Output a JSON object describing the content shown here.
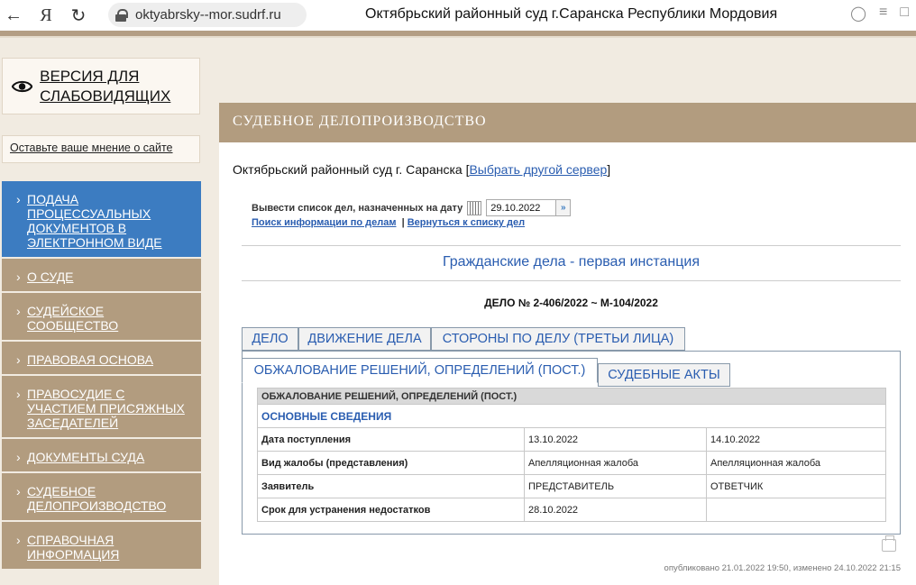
{
  "browser": {
    "url": "oktyabrsky--mor.sudrf.ru",
    "page_title": "Октябрьский районный суд г.Саранска Республики Мордовия"
  },
  "sidebar": {
    "vision_label": "ВЕРСИЯ ДЛЯ СЛАБОВИДЯЩИХ",
    "opinion_link": "Оставьте ваше мнение о сайте",
    "items": [
      {
        "label": "Подача процессуальных документов в электронном виде",
        "active": true
      },
      {
        "label": "О суде"
      },
      {
        "label": "Судейское сообщество"
      },
      {
        "label": "Правовая основа"
      },
      {
        "label": "Правосудие с участием присяжных заседателей"
      },
      {
        "label": "Документы суда"
      },
      {
        "label": "Судебное делопроизводство"
      },
      {
        "label": "Справочная информация"
      }
    ]
  },
  "main": {
    "section_title": "СУДЕБНОЕ ДЕЛОПРОИЗВОДСТВО",
    "court_name": "Октябрьский районный суд г. Саранска",
    "bracket_open": "[",
    "change_server_link": "Выбрать другой сервер",
    "bracket_close": "]",
    "date_label": "Вывести список дел, назначенных на дату",
    "date_value": "29.10.2022",
    "search_link": "Поиск информации по делам",
    "separator": "|",
    "back_link": "Вернуться к списку дел",
    "case_type": "Гражданские дела - первая инстанция",
    "case_number": "ДЕЛО № 2-406/2022 ~ М-104/2022",
    "tabs_row1": [
      "ДЕЛО",
      "ДВИЖЕНИЕ ДЕЛА",
      "СТОРОНЫ ПО ДЕЛУ (ТРЕТЬИ ЛИЦА)"
    ],
    "tabs_row2": [
      "ОБЖАЛОВАНИЕ РЕШЕНИЙ, ОПРЕДЕЛЕНИЙ (ПОСТ.)",
      "СУДЕБНЫЕ АКТЫ"
    ],
    "table": {
      "header": "ОБЖАЛОВАНИЕ РЕШЕНИЙ, ОПРЕДЕЛЕНИЙ (ПОСТ.)",
      "subheader": "ОСНОВНЫЕ СВЕДЕНИЯ",
      "rows": [
        {
          "label": "Дата поступления",
          "v1": "13.10.2022",
          "v2": "14.10.2022"
        },
        {
          "label": "Вид жалобы (представления)",
          "v1": "Апелляционная жалоба",
          "v2": "Апелляционная жалоба"
        },
        {
          "label": "Заявитель",
          "v1": "ПРЕДСТАВИТЕЛЬ",
          "v2": "ОТВЕТЧИК"
        },
        {
          "label": "Срок для устранения недостатков",
          "v1": "28.10.2022",
          "v2": ""
        }
      ]
    },
    "published": "опубликовано 21.01.2022 19:50, изменено 24.10.2022 21:15"
  }
}
